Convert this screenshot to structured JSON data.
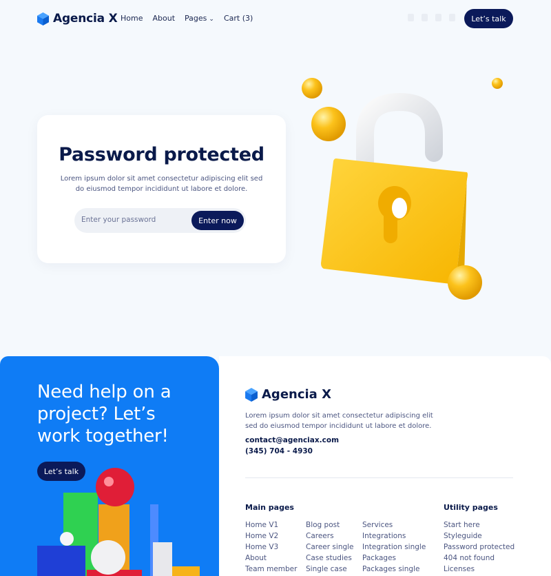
{
  "nav": {
    "brand": "Agencia X",
    "links": [
      "Home",
      "About",
      "Pages",
      "Cart (3)"
    ],
    "socials": [
      "facebook-icon",
      "twitter-icon",
      "instagram-icon",
      "linkedin-icon"
    ],
    "cta": "Let’s talk"
  },
  "hero": {
    "title": "Password protected",
    "description": "Lorem ipsum dolor sit amet consectetur adipiscing elit sed do eiusmod tempor incididunt ut labore et dolore.",
    "password_placeholder": "Enter your password",
    "submit": "Enter now"
  },
  "footer": {
    "cta_title": "Need help on a project? Let’s work together!",
    "cta_button": "Let’s talk",
    "brand": "Agencia X",
    "description": "Lorem ipsum dolor sit amet consectetur adipiscing elit sed do eiusmod tempor incididunt ut labore et dolore.",
    "email": "contact@agenciax.com",
    "phone": "(345) 704 - 4930",
    "main_pages_heading": "Main pages",
    "main_col1": [
      "Home V1",
      "Home V2",
      "Home V3",
      "About",
      "Team member"
    ],
    "main_col2": [
      "Blog post",
      "Careers",
      "Career single",
      "Case studies",
      "Single case"
    ],
    "main_col3": [
      "Services",
      "Integrations",
      "Integration single",
      "Packages",
      "Packages single"
    ],
    "utility_heading": "Utility pages",
    "utility_col": [
      "Start here",
      "Styleguide",
      "Password protected",
      "404 not found",
      "Licenses"
    ]
  },
  "colors": {
    "navy": "#0b1a5a",
    "blue": "#0f7cf5",
    "yellow": "#fbc531",
    "background": "#f5f9fd"
  }
}
